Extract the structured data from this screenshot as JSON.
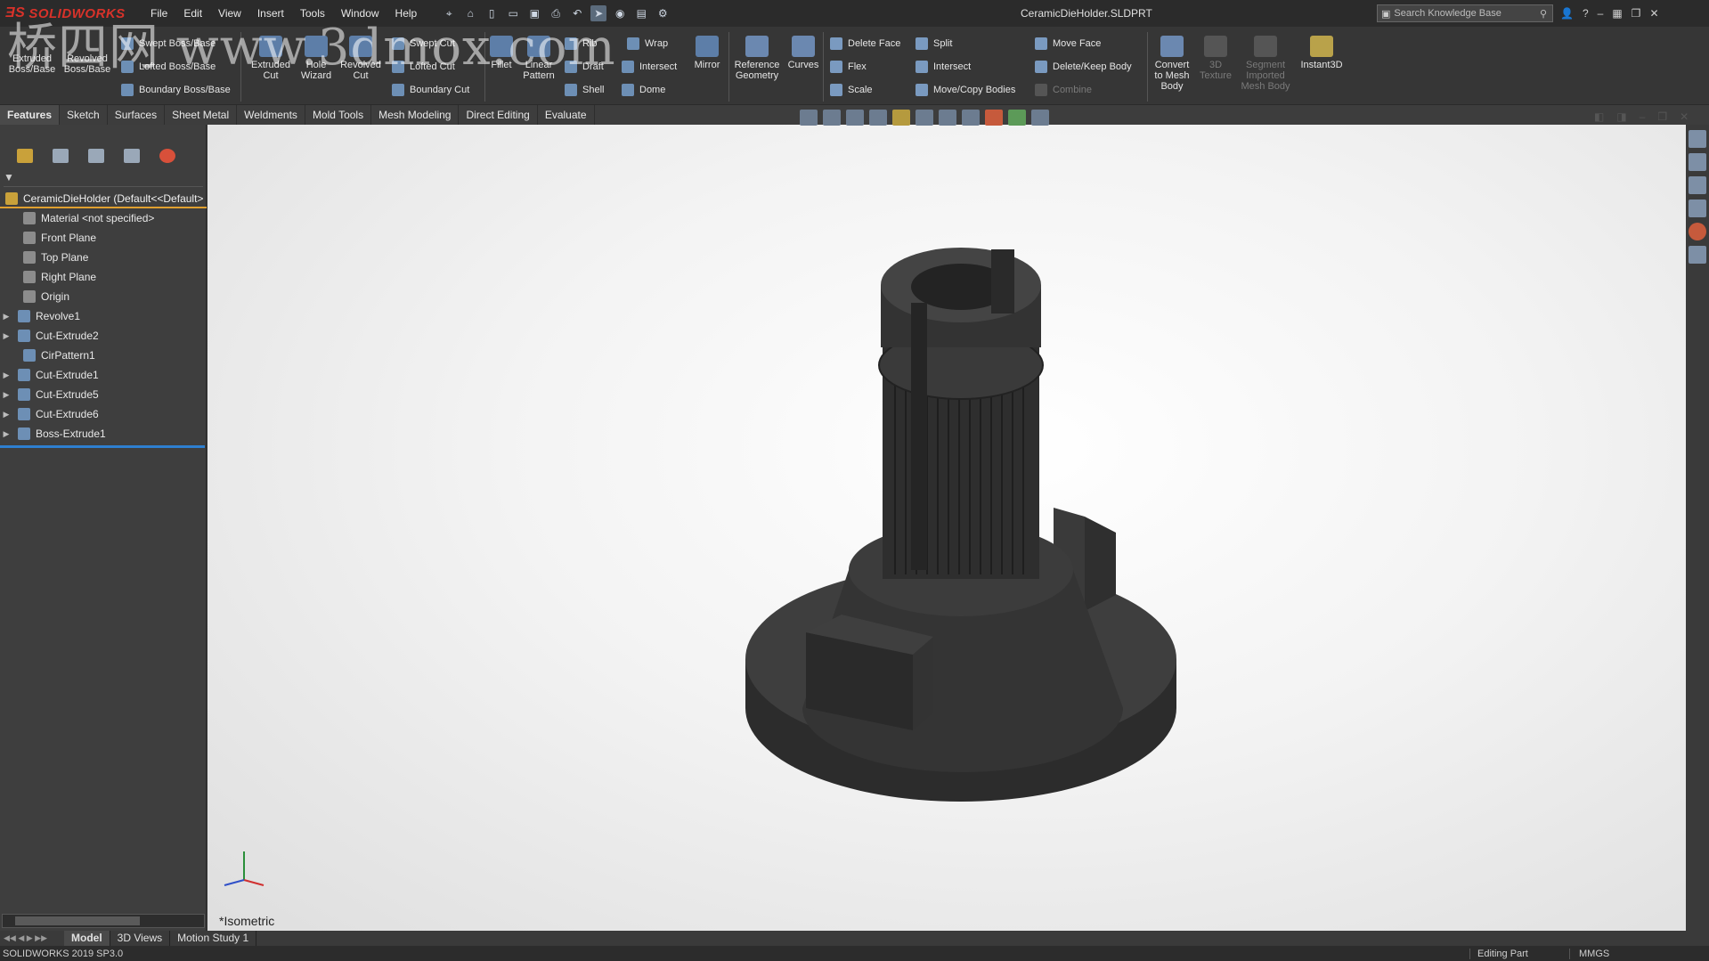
{
  "app": {
    "logo_text": "SOLIDWORKS",
    "document_title": "CeramicDieHolder.SLDPRT"
  },
  "menu": {
    "items": [
      "File",
      "Edit",
      "View",
      "Insert",
      "Tools",
      "Window",
      "Help"
    ]
  },
  "search": {
    "placeholder": "Search Knowledge Base"
  },
  "ribbon": {
    "extruded_boss": "Extruded Boss/Base",
    "revolved_boss": "Revolved Boss/Base",
    "swept_boss": "Swept Boss/Base",
    "lofted_boss": "Lofted Boss/Base",
    "boundary_boss": "Boundary Boss/Base",
    "extruded_cut": "Extruded Cut",
    "hole_wizard": "Hole Wizard",
    "revolved_cut": "Revolved Cut",
    "swept_cut": "Swept Cut",
    "lofted_cut": "Lofted Cut",
    "boundary_cut": "Boundary Cut",
    "fillet": "Fillet",
    "linear_pattern": "Linear Pattern",
    "rib": "Rib",
    "wrap": "Wrap",
    "draft": "Draft",
    "intersect1": "Intersect",
    "shell": "Shell",
    "dome": "Dome",
    "mirror": "Mirror",
    "reference_geometry": "Reference Geometry",
    "curves": "Curves",
    "delete_face": "Delete Face",
    "flex": "Flex",
    "scale": "Scale",
    "split": "Split",
    "intersect2": "Intersect",
    "move_copy_bodies": "Move/Copy Bodies",
    "move_face": "Move Face",
    "delete_keep_body": "Delete/Keep Body",
    "combine": "Combine",
    "convert_mesh": "Convert to Mesh Body",
    "texture_3d": "3D Texture",
    "segment_mesh": "Segment Imported Mesh Body",
    "instant3d": "Instant3D"
  },
  "tabs": [
    "Features",
    "Sketch",
    "Surfaces",
    "Sheet Metal",
    "Weldments",
    "Mold Tools",
    "Mesh Modeling",
    "Direct Editing",
    "Evaluate"
  ],
  "tree": {
    "root": "CeramicDieHolder  (Default<<Default>",
    "items": [
      {
        "label": "Material <not specified>",
        "expandable": false
      },
      {
        "label": "Front Plane",
        "expandable": false
      },
      {
        "label": "Top Plane",
        "expandable": false
      },
      {
        "label": "Right Plane",
        "expandable": false
      },
      {
        "label": "Origin",
        "expandable": false
      },
      {
        "label": "Revolve1",
        "expandable": true
      },
      {
        "label": "Cut-Extrude2",
        "expandable": true
      },
      {
        "label": "CirPattern1",
        "expandable": false
      },
      {
        "label": "Cut-Extrude1",
        "expandable": true
      },
      {
        "label": "Cut-Extrude5",
        "expandable": true
      },
      {
        "label": "Cut-Extrude6",
        "expandable": true
      },
      {
        "label": "Boss-Extrude1",
        "expandable": true
      }
    ]
  },
  "viewport": {
    "view_label": "*Isometric"
  },
  "model_tabs": [
    "Model",
    "3D Views",
    "Motion Study 1"
  ],
  "status": {
    "version": "SOLIDWORKS 2019 SP3.0",
    "editing": "Editing Part",
    "units": "MMGS"
  },
  "watermark": "桥四网 www.3dmox.com",
  "colors": {
    "part": "#3a3a3a",
    "rollback": "#2e7fd0",
    "root_underline": "#e0a030"
  }
}
